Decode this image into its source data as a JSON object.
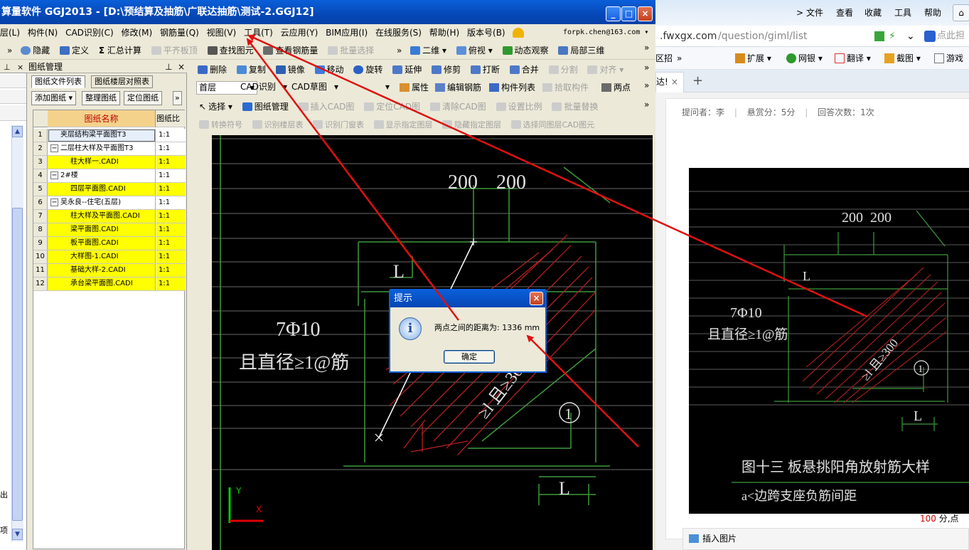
{
  "app": {
    "title": "算量软件 GGJ2013 - [D:\\预结算及抽筋\\广联达抽筋\\测试-2.GGJ12]",
    "window_buttons": [
      "_",
      "□",
      "×"
    ],
    "menu": [
      "层(L)",
      "构件(N)",
      "CAD识别(C)",
      "修改(M)",
      "钢筋量(Q)",
      "视图(V)",
      "工具(T)",
      "云应用(Y)",
      "BIM应用(I)",
      "在线服务(S)",
      "帮助(H)",
      "版本号(B)"
    ],
    "account": "forpk.chen@163.com",
    "toolbar1": {
      "chevron": "»",
      "hide": "隐藏",
      "define": "定义",
      "sum": "汇总计算",
      "sum_icon": "Σ",
      "align_top": "平齐板顶",
      "find": "查找图元",
      "rebar_view": "查看钢筋量",
      "batch_select": "批量选择",
      "view2d": "二维",
      "top_view": "俯视",
      "dynamic": "动态观察",
      "local3d": "局部三维"
    },
    "narrow_panel": {
      "pin": "⊥",
      "close": "×",
      "side_a": "出",
      "side_b": "项"
    },
    "drawing_manager": {
      "title": "图纸管理",
      "pin": "⊥",
      "close": "×",
      "tabs": [
        "图纸文件列表",
        "图纸楼层对照表"
      ],
      "buttons": [
        "添加图纸",
        "整理图纸",
        "定位图纸"
      ],
      "more": "»",
      "columns": [
        "图纸名称",
        "图纸比"
      ],
      "rows": [
        {
          "n": "1",
          "name": "夹层结构梁平面图T3",
          "scale": "1:1",
          "indent": 1,
          "yellow": false,
          "sel": true
        },
        {
          "n": "2",
          "name": "二层柱大样及平面图T3",
          "scale": "1:1",
          "indent": 0,
          "toggle": "−",
          "yellow": false
        },
        {
          "n": "3",
          "name": "柱大样一.CADI",
          "scale": "1:1",
          "indent": 2,
          "yellow": true
        },
        {
          "n": "4",
          "name": "2#楼",
          "scale": "1:1",
          "indent": 0,
          "toggle": "−",
          "yellow": false
        },
        {
          "n": "5",
          "name": "四层平面图.CADI",
          "scale": "1:1",
          "indent": 2,
          "yellow": true
        },
        {
          "n": "6",
          "name": "吴永良--住宅(五层)",
          "scale": "1:1",
          "indent": 0,
          "toggle": "−",
          "yellow": false
        },
        {
          "n": "7",
          "name": "柱大样及平面图.CADI",
          "scale": "1:1",
          "indent": 2,
          "yellow": true
        },
        {
          "n": "8",
          "name": "梁平面图.CADI",
          "scale": "1:1",
          "indent": 2,
          "yellow": true
        },
        {
          "n": "9",
          "name": "板平面图.CADI",
          "scale": "1:1",
          "indent": 2,
          "yellow": true
        },
        {
          "n": "10",
          "name": "大样图-1.CADI",
          "scale": "1:1",
          "indent": 2,
          "yellow": true
        },
        {
          "n": "11",
          "name": "基础大样-2.CADI",
          "scale": "1:1",
          "indent": 2,
          "yellow": true
        },
        {
          "n": "12",
          "name": "承台梁平面图.CADI",
          "scale": "1:1",
          "indent": 2,
          "yellow": true
        }
      ]
    },
    "toolbar2": {
      "delete": "删除",
      "copy": "复制",
      "mirror": "镜像",
      "move": "移动",
      "rotate": "旋转",
      "extend": "延伸",
      "trim": "修剪",
      "break": "打断",
      "merge": "合并",
      "split": "分割",
      "align": "对齐",
      "more": "»"
    },
    "toolbar3": {
      "layer": "首层",
      "cad_recog": "CAD识别",
      "cad_sketch": "CAD草图",
      "props": "属性",
      "edit_rebar": "编辑钢筋",
      "comp_list": "构件列表",
      "pick_comp": "拾取构件",
      "two_point": "两点",
      "more": "»"
    },
    "toolbar4": {
      "select": "选择",
      "drawing_mgmt": "图纸管理",
      "insert_cad": "插入CAD图",
      "locate_cad": "定位CAD图",
      "clear_cad": "清除CAD图",
      "set_scale": "设置比例",
      "batch_replace": "批量替换",
      "more": "»"
    },
    "toolbar5": {
      "convert_symbol": "转换符号",
      "recog_floor": "识别楼层表",
      "recog_door": "识别门窗表",
      "show_layer": "显示指定图层",
      "hide_layer": "隐藏指定图层",
      "select_same": "选择同图层CAD图元"
    },
    "cad": {
      "dim1": "200",
      "dim2": "200",
      "label_l": "L",
      "rebar": "7Φ10",
      "note": "且直径≥1@筋",
      "diag_label": "≥l 且≥300",
      "circle": "1",
      "axis_y": "Y",
      "axis_x": "X"
    },
    "dialog": {
      "title": "提示",
      "message": "两点之间的距离为: 1336 mm",
      "ok": "确定",
      "close": "×",
      "icon": "i"
    }
  },
  "browser": {
    "menu": [
      "文件",
      "查看",
      "收藏",
      "工具",
      "帮助"
    ],
    "chevron_left": ">",
    "url_host": ".fwxgx.com",
    "url_path": "/question/giml/list",
    "search_hint": "点此担",
    "fav": {
      "left": "区招",
      "chev": "»",
      "ext": "扩展",
      "bank": "网银",
      "translate": "翻译",
      "screenshot": "截图",
      "games": "游戏"
    },
    "tab_label": "达!",
    "tab_close": "×",
    "tab_add": "+",
    "meta": {
      "asker": "提问者：李",
      "reward": "悬赏分：5分",
      "answers": "回答次数：1次",
      "sep": "|"
    },
    "image": {
      "dim1": "200",
      "dim2": "200",
      "rebar": "7Φ10",
      "note": "且直径≥1@筋",
      "diag_label": "≥l 且≥300",
      "circle": "1",
      "label_l": "L",
      "caption": "图十三   板悬挑阳角放射筋大样",
      "caption2": "a<边跨支座负筋间距"
    },
    "score_num": "100",
    "score_text": "分,点",
    "insert_image": "插入图片"
  },
  "colors": {
    "title_blue": "#0a5fd8",
    "arrow_red": "#e01010",
    "row_yellow": "#ffff00",
    "cad_green": "#3c8c3c",
    "cad_red": "#c02020"
  }
}
